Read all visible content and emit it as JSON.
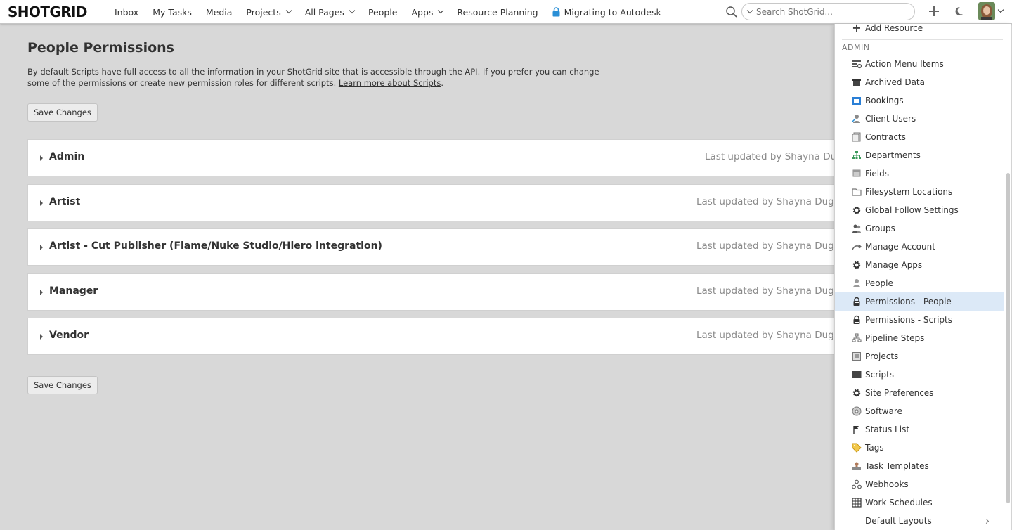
{
  "topbar": {
    "logo": "SHOTGRID",
    "nav": [
      {
        "label": "Inbox",
        "dropdown": false
      },
      {
        "label": "My Tasks",
        "dropdown": false
      },
      {
        "label": "Media",
        "dropdown": false
      },
      {
        "label": "Projects",
        "dropdown": true
      },
      {
        "label": "All Pages",
        "dropdown": true
      },
      {
        "label": "People",
        "dropdown": false
      },
      {
        "label": "Apps",
        "dropdown": true
      },
      {
        "label": "Resource Planning",
        "dropdown": false
      },
      {
        "label": "Migrating to Autodesk",
        "dropdown": false,
        "icon": "lock-icon"
      }
    ],
    "search_placeholder": "Search ShotGrid..."
  },
  "main": {
    "title": "People Permissions",
    "description": "By default Scripts have full access to all the information in your ShotGrid site that is accessible through the API. If you prefer you can change some of the permissions or create new permission roles for different scripts.",
    "learn_more": "Learn more about Scripts",
    "save_label": "Save Changes",
    "roles": [
      {
        "name": "Admin",
        "updated": "Last updated by Shayna Dug"
      },
      {
        "name": "Artist",
        "updated": "Last updated by Shayna Dugu"
      },
      {
        "name": "Artist - Cut Publisher (Flame/Nuke Studio/Hiero integration)",
        "updated": "Last updated by Shayna Dugu"
      },
      {
        "name": "Manager",
        "updated": "Last updated by Shayna Dugu"
      },
      {
        "name": "Vendor",
        "updated": "Last updated by Shayna Dugu"
      }
    ]
  },
  "menu": {
    "add_resource": "Add Resource",
    "section_header": "ADMIN",
    "items": [
      {
        "label": "Action Menu Items",
        "icon": "action-menu-icon"
      },
      {
        "label": "Archived Data",
        "icon": "archive-box-icon"
      },
      {
        "label": "Bookings",
        "icon": "calendar-icon"
      },
      {
        "label": "Client Users",
        "icon": "client-user-icon"
      },
      {
        "label": "Contracts",
        "icon": "contract-document-icon"
      },
      {
        "label": "Departments",
        "icon": "org-chart-icon"
      },
      {
        "label": "Fields",
        "icon": "field-icon"
      },
      {
        "label": "Filesystem Locations",
        "icon": "folder-icon"
      },
      {
        "label": "Global Follow Settings",
        "icon": "gear-icon"
      },
      {
        "label": "Groups",
        "icon": "group-icon"
      },
      {
        "label": "Manage Account",
        "icon": "account-arrow-icon"
      },
      {
        "label": "Manage Apps",
        "icon": "gear-icon"
      },
      {
        "label": "People",
        "icon": "person-icon"
      },
      {
        "label": "Permissions - People",
        "icon": "lock-icon",
        "active": true
      },
      {
        "label": "Permissions - Scripts",
        "icon": "lock-icon"
      },
      {
        "label": "Pipeline Steps",
        "icon": "pipeline-steps-icon"
      },
      {
        "label": "Projects",
        "icon": "project-icon"
      },
      {
        "label": "Scripts",
        "icon": "terminal-icon"
      },
      {
        "label": "Site Preferences",
        "icon": "gear-icon"
      },
      {
        "label": "Software",
        "icon": "software-disc-icon"
      },
      {
        "label": "Status List",
        "icon": "flag-icon"
      },
      {
        "label": "Tags",
        "icon": "tag-icon"
      },
      {
        "label": "Task Templates",
        "icon": "stamp-icon"
      },
      {
        "label": "Webhooks",
        "icon": "webhook-icon"
      },
      {
        "label": "Work Schedules",
        "icon": "grid-calendar-icon"
      }
    ],
    "default_layouts": "Default Layouts"
  },
  "colors": {
    "active_bg": "#dce9f7",
    "page_bg": "#d8d8d8",
    "lock_blue": "#2a8fd6"
  }
}
